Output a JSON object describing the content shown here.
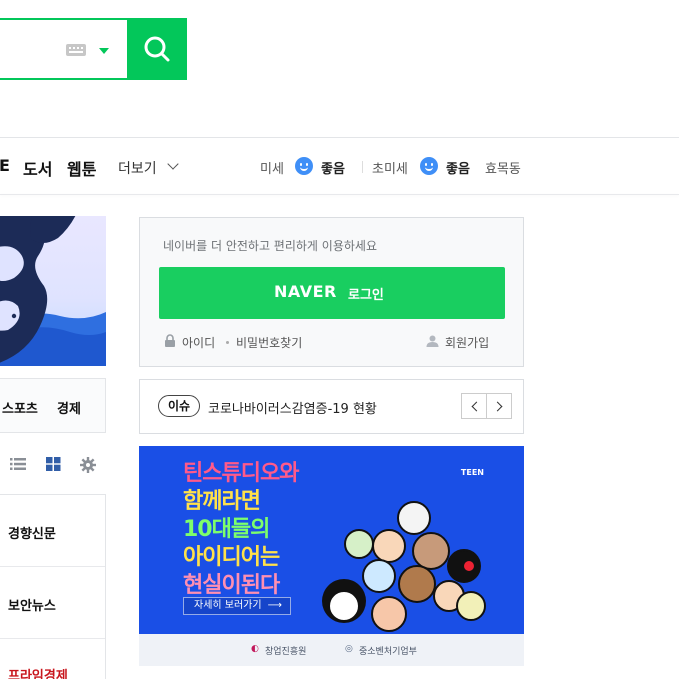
{
  "search": {
    "keyboard_icon": "keyboard-icon",
    "dropdown_icon": "caret-down-icon",
    "button_icon": "search-icon",
    "accent": "#03c75a"
  },
  "nav": {
    "items": [
      "E",
      "도서",
      "웹툰"
    ],
    "more_label": "더보기"
  },
  "weather": {
    "fine_dust_label": "미세",
    "fine_dust_status": "좋음",
    "ultra_fine_dust_label": "초미세",
    "ultra_fine_dust_status": "좋음",
    "location": "효목동",
    "status_icon": "smile-face-icon",
    "status_color": "#3f8ff7"
  },
  "news_tabs": [
    "스포츠",
    "경제"
  ],
  "press": [
    "경향신문",
    "보안뉴스",
    "프라임경제"
  ],
  "login": {
    "description": "네이버를 더 안전하고 편리하게 이용하세요",
    "brand": "NAVER",
    "button_label": "로그인",
    "find_id": "아이디",
    "find_password": "비밀번호찾기",
    "signup": "회원가입",
    "button_color": "#19ce60"
  },
  "issue": {
    "badge": "이슈",
    "text": "코로나바이러스감염증-19 현황"
  },
  "ad": {
    "headline": [
      "틴스튜디오와",
      "함께라면",
      "10대들의",
      "아이디어는",
      "현실이된다"
    ],
    "cta": "자세히 보러가기",
    "brand": "TEEN",
    "sponsor1": "창업진흥원",
    "sponsor2": "중소벤처기업부",
    "background": "#1a4fe6"
  }
}
